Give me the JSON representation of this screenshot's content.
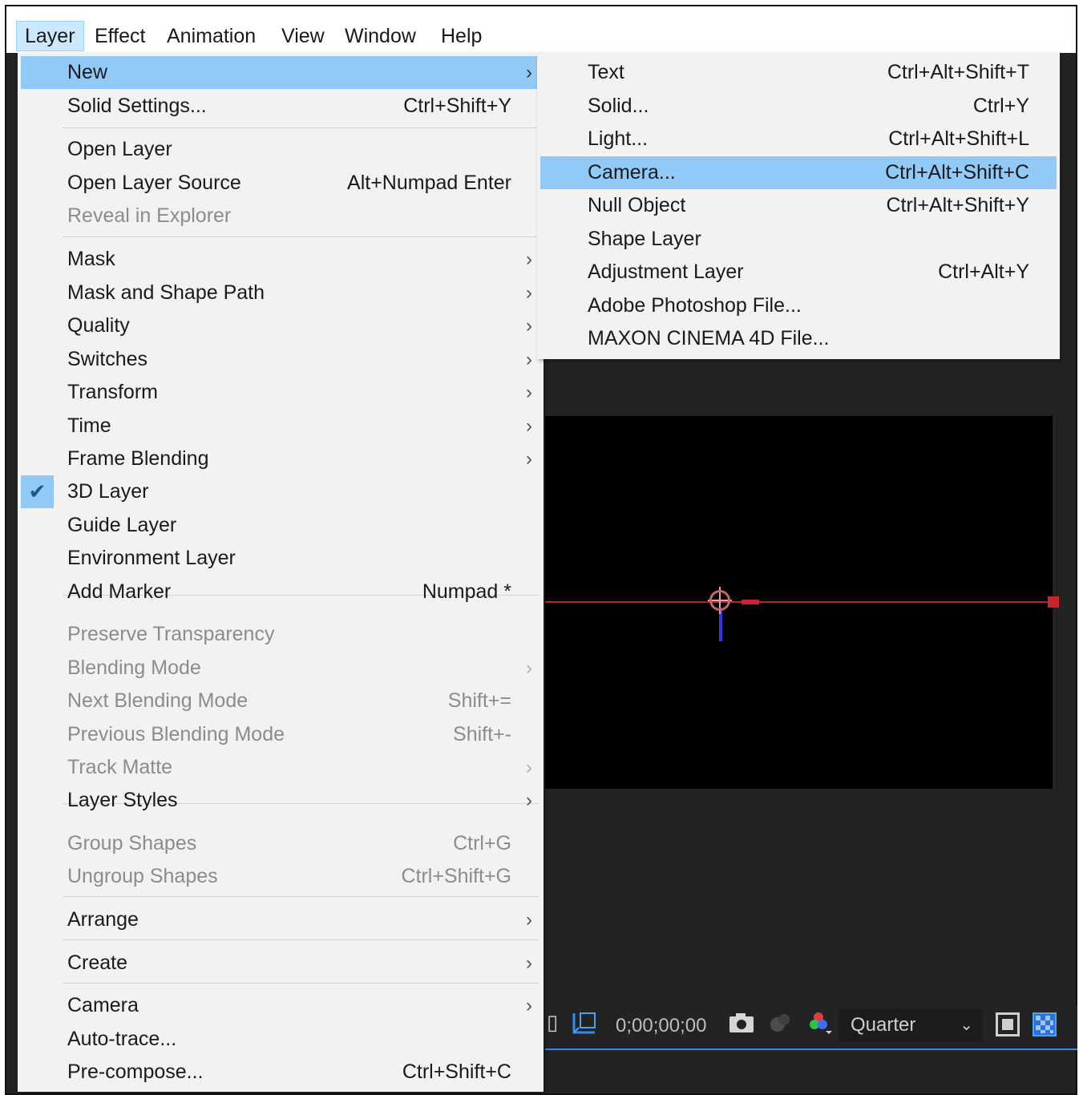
{
  "menubar": [
    "Layer",
    "Effect",
    "Animation",
    "View",
    "Window",
    "Help"
  ],
  "layer_menu": [
    {
      "label": "New",
      "shortcut": "",
      "arrow": "›",
      "state": "highlighted"
    },
    {
      "label": "Solid Settings...",
      "shortcut": "Ctrl+Shift+Y",
      "arrow": "",
      "state": "enabled"
    },
    {
      "label": "Open Layer",
      "shortcut": "",
      "arrow": "",
      "state": "enabled"
    },
    {
      "label": "Open Layer Source",
      "shortcut": "Alt+Numpad Enter",
      "arrow": "",
      "state": "enabled"
    },
    {
      "label": "Reveal in Explorer",
      "shortcut": "",
      "arrow": "",
      "state": "disabled"
    },
    {
      "label": "Mask",
      "shortcut": "",
      "arrow": "›",
      "state": "enabled"
    },
    {
      "label": "Mask and Shape Path",
      "shortcut": "",
      "arrow": "›",
      "state": "enabled"
    },
    {
      "label": "Quality",
      "shortcut": "",
      "arrow": "›",
      "state": "enabled"
    },
    {
      "label": "Switches",
      "shortcut": "",
      "arrow": "›",
      "state": "enabled"
    },
    {
      "label": "Transform",
      "shortcut": "",
      "arrow": "›",
      "state": "enabled"
    },
    {
      "label": "Time",
      "shortcut": "",
      "arrow": "›",
      "state": "enabled"
    },
    {
      "label": "Frame Blending",
      "shortcut": "",
      "arrow": "›",
      "state": "enabled"
    },
    {
      "label": "3D Layer",
      "shortcut": "",
      "arrow": "",
      "state": "checked"
    },
    {
      "label": "Guide Layer",
      "shortcut": "",
      "arrow": "",
      "state": "enabled"
    },
    {
      "label": "Environment Layer",
      "shortcut": "",
      "arrow": "",
      "state": "enabled"
    },
    {
      "label": "Add Marker",
      "shortcut": "Numpad *",
      "arrow": "",
      "state": "enabled"
    },
    {
      "label": "Preserve Transparency",
      "shortcut": "",
      "arrow": "",
      "state": "disabled"
    },
    {
      "label": "Blending Mode",
      "shortcut": "",
      "arrow": "›",
      "state": "disabled"
    },
    {
      "label": "Next Blending Mode",
      "shortcut": "Shift+=",
      "arrow": "",
      "state": "disabled"
    },
    {
      "label": "Previous Blending Mode",
      "shortcut": "Shift+-",
      "arrow": "",
      "state": "disabled"
    },
    {
      "label": "Track Matte",
      "shortcut": "",
      "arrow": "›",
      "state": "disabled"
    },
    {
      "label": "Layer Styles",
      "shortcut": "",
      "arrow": "›",
      "state": "enabled"
    },
    {
      "label": "Group Shapes",
      "shortcut": "Ctrl+G",
      "arrow": "",
      "state": "disabled"
    },
    {
      "label": "Ungroup Shapes",
      "shortcut": "Ctrl+Shift+G",
      "arrow": "",
      "state": "disabled"
    },
    {
      "label": "Arrange",
      "shortcut": "",
      "arrow": "›",
      "state": "enabled"
    },
    {
      "label": "Create",
      "shortcut": "",
      "arrow": "›",
      "state": "enabled"
    },
    {
      "label": "Camera",
      "shortcut": "",
      "arrow": "›",
      "state": "enabled"
    },
    {
      "label": "Auto-trace...",
      "shortcut": "",
      "arrow": "",
      "state": "enabled"
    },
    {
      "label": "Pre-compose...",
      "shortcut": "Ctrl+Shift+C",
      "arrow": "",
      "state": "enabled"
    }
  ],
  "new_submenu": [
    {
      "label": "Text",
      "shortcut": "Ctrl+Alt+Shift+T",
      "state": "enabled"
    },
    {
      "label": "Solid...",
      "shortcut": "Ctrl+Y",
      "state": "enabled"
    },
    {
      "label": "Light...",
      "shortcut": "Ctrl+Alt+Shift+L",
      "state": "enabled"
    },
    {
      "label": "Camera...",
      "shortcut": "Ctrl+Alt+Shift+C",
      "state": "highlighted"
    },
    {
      "label": "Null Object",
      "shortcut": "Ctrl+Alt+Shift+Y",
      "state": "enabled"
    },
    {
      "label": "Shape Layer",
      "shortcut": "",
      "state": "enabled"
    },
    {
      "label": "Adjustment Layer",
      "shortcut": "Ctrl+Alt+Y",
      "state": "enabled"
    },
    {
      "label": "Adobe Photoshop File...",
      "shortcut": "",
      "state": "enabled"
    },
    {
      "label": "MAXON CINEMA 4D File...",
      "shortcut": "",
      "state": "enabled"
    }
  ],
  "viewer": {
    "timecode": "0;00;00;00",
    "resolution": "Quarter",
    "icons": [
      "region-of-interest-icon",
      "snapshot-camera-icon",
      "show-snapshot-icon",
      "color-channels-icon",
      "fast-previews-icon",
      "transparency-grid-icon"
    ]
  },
  "colors": {
    "highlight": "#91c9f7",
    "menu_bg": "#f2f2f2",
    "disabled_text": "#8c8c8c",
    "app_bg": "#232323",
    "motion_path": "#b3262b",
    "timeline_accent": "#2d8ceb"
  }
}
